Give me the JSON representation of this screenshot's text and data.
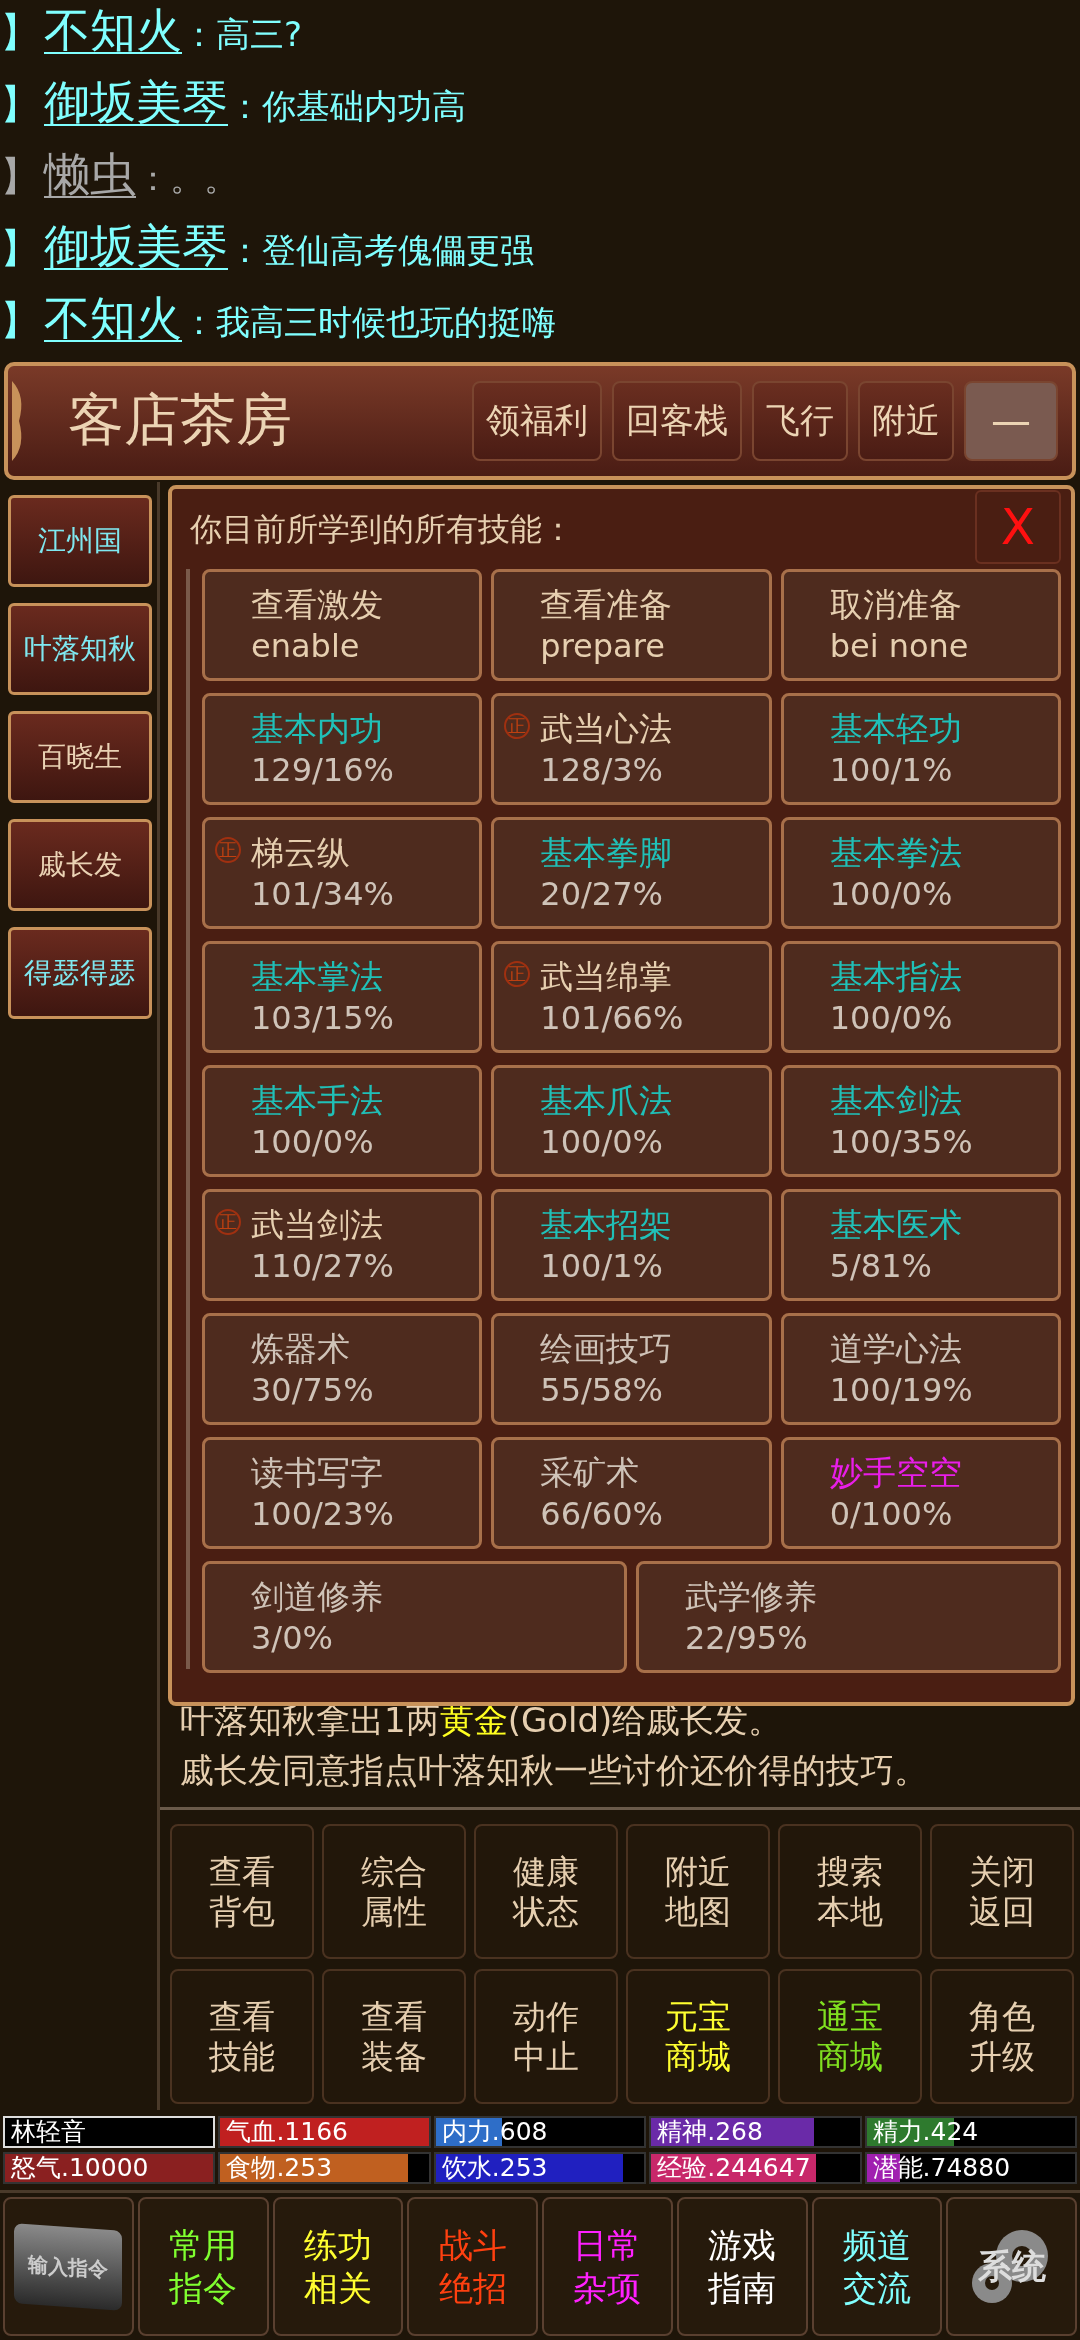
{
  "chat": [
    {
      "prefix": "】",
      "name": "不知火",
      "message": "：高三?",
      "color": "#80ffff"
    },
    {
      "prefix": "】",
      "name": "御坂美琴",
      "message": "：你基础内功高",
      "color": "#80ffff"
    },
    {
      "prefix": "】",
      "name": "懒虫",
      "message": "：。。",
      "color": "#a8a8a8"
    },
    {
      "prefix": "】",
      "name": "御坂美琴",
      "message": "：登仙高考傀儡更强",
      "color": "#80ffff"
    },
    {
      "prefix": "】",
      "name": "不知火",
      "message": "：我高三时候也玩的挺嗨",
      "color": "#80ffff"
    }
  ],
  "header": {
    "title": "客店茶房",
    "buttons": [
      "领福利",
      "回客栈",
      "飞行",
      "附近"
    ],
    "minimize": "—"
  },
  "sidebar": [
    {
      "label": "江州国",
      "color": "#7fe8f0"
    },
    {
      "label": "叶落知秋",
      "color": "#7fe8f0"
    },
    {
      "label": "百晓生",
      "color": "#ead2b4"
    },
    {
      "label": "戚长发",
      "color": "#ead2b4"
    },
    {
      "label": "得瑟得瑟",
      "color": "#7fe8f0"
    }
  ],
  "dialog": {
    "title": "你目前所学到的所有技能：",
    "close": "X",
    "commands": [
      {
        "label": "查看激发",
        "sub": "enable"
      },
      {
        "label": "查看准备",
        "sub": "prepare"
      },
      {
        "label": "取消准备",
        "sub": "bei none"
      }
    ],
    "skills": [
      {
        "name": "基本内功",
        "value": "129/16%",
        "color": "#20c0b8"
      },
      {
        "name": "武当心法",
        "value": "128/3%",
        "color": "#e6cfb0",
        "badge": "正"
      },
      {
        "name": "基本轻功",
        "value": "100/1%",
        "color": "#20c0b8"
      },
      {
        "name": "梯云纵",
        "value": "101/34%",
        "color": "#e6cfb0",
        "badge": "正"
      },
      {
        "name": "基本拳脚",
        "value": "20/27%",
        "color": "#20c0b8"
      },
      {
        "name": "基本拳法",
        "value": "100/0%",
        "color": "#20c0b8"
      },
      {
        "name": "基本掌法",
        "value": "103/15%",
        "color": "#20c0b8"
      },
      {
        "name": "武当绵掌",
        "value": "101/66%",
        "color": "#e6cfb0",
        "badge": "正"
      },
      {
        "name": "基本指法",
        "value": "100/0%",
        "color": "#20c0b8"
      },
      {
        "name": "基本手法",
        "value": "100/0%",
        "color": "#20c0b8"
      },
      {
        "name": "基本爪法",
        "value": "100/0%",
        "color": "#20c0b8"
      },
      {
        "name": "基本剑法",
        "value": "100/35%",
        "color": "#20c0b8"
      },
      {
        "name": "武当剑法",
        "value": "110/27%",
        "color": "#e6cfb0",
        "badge": "正"
      },
      {
        "name": "基本招架",
        "value": "100/1%",
        "color": "#20c0b8"
      },
      {
        "name": "基本医术",
        "value": "5/81%",
        "color": "#20c0b8"
      },
      {
        "name": "炼器术",
        "value": "30/75%",
        "color": "#cfc3b8"
      },
      {
        "name": "绘画技巧",
        "value": "55/58%",
        "color": "#cfc3b8"
      },
      {
        "name": "道学心法",
        "value": "100/19%",
        "color": "#cfc3b8"
      },
      {
        "name": "读书写字",
        "value": "100/23%",
        "color": "#cfc3b8"
      },
      {
        "name": "采矿术",
        "value": "66/60%",
        "color": "#cfc3b8"
      },
      {
        "name": "妙手空空",
        "value": "0/100%",
        "color": "#e81ee8"
      },
      {
        "name": "剑道修养",
        "value": "3/0%",
        "color": "#cfc3b8"
      },
      {
        "name": "武学修养",
        "value": "22/95%",
        "color": "#cfc3b8"
      }
    ]
  },
  "log": [
    [
      {
        "text": "叶落知秋拿出1两"
      },
      {
        "text": "黄金",
        "color": "#ffff20"
      },
      {
        "text": "(Gold)给戚长发。"
      }
    ],
    [
      {
        "text": "戚长发同意指点叶落知秋一些讨价还价得的技巧。"
      }
    ]
  ],
  "actions": [
    {
      "label": "查看背包",
      "color": "#e6cfb0"
    },
    {
      "label": "综合属性",
      "color": "#e6cfb0"
    },
    {
      "label": "健康状态",
      "color": "#e6cfb0"
    },
    {
      "label": "附近地图",
      "color": "#e6cfb0"
    },
    {
      "label": "搜索本地",
      "color": "#e6cfb0"
    },
    {
      "label": "关闭返回",
      "color": "#e6cfb0"
    },
    {
      "label": "查看技能",
      "color": "#e6cfb0"
    },
    {
      "label": "查看装备",
      "color": "#e6cfb0"
    },
    {
      "label": "动作中止",
      "color": "#e6cfb0"
    },
    {
      "label": "元宝商城",
      "color": "#ffff30"
    },
    {
      "label": "通宝商城",
      "color": "#80e020"
    },
    {
      "label": "角色升级",
      "color": "#e6cfb0"
    }
  ],
  "stats": [
    {
      "kind": "name",
      "label": "林轻音"
    },
    {
      "kind": "meter",
      "label": "气血.1166",
      "level": 1.0,
      "color": "#c02020"
    },
    {
      "kind": "meter",
      "label": "内力.608",
      "level": 0.32,
      "color": "#2e6ec8"
    },
    {
      "kind": "meter",
      "label": "精神.268",
      "level": 0.78,
      "color": "#6a2aa8"
    },
    {
      "kind": "meter",
      "label": "精力.424",
      "level": 0.42,
      "color": "#2e7a2e"
    },
    {
      "kind": "meter",
      "label": "怒气.10000",
      "level": 1.0,
      "color": "#8a2020"
    },
    {
      "kind": "meter",
      "label": "食物.253",
      "level": 0.9,
      "color": "#c06020"
    },
    {
      "kind": "meter",
      "label": "饮水.253",
      "level": 0.9,
      "color": "#2020c0"
    },
    {
      "kind": "meter",
      "label": "经验.244647",
      "level": 0.79,
      "color": "#c8286a"
    },
    {
      "kind": "meter",
      "label": "潜能.74880",
      "level": 0.16,
      "color": "#a020b0"
    }
  ],
  "bottom": [
    {
      "kind": "input",
      "label": "输入指令"
    },
    {
      "kind": "menu",
      "label": "常用指令",
      "color": "#80ff30"
    },
    {
      "kind": "menu",
      "label": "练功相关",
      "color": "#ffff30"
    },
    {
      "kind": "menu",
      "label": "战斗绝招",
      "color": "#ff4010"
    },
    {
      "kind": "menu",
      "label": "日常杂项",
      "color": "#ff20ff"
    },
    {
      "kind": "menu",
      "label": "游戏指南",
      "color": "#ffffff"
    },
    {
      "kind": "menu",
      "label": "频道交流",
      "color": "#80ffff"
    },
    {
      "kind": "system",
      "label": "系统"
    }
  ]
}
